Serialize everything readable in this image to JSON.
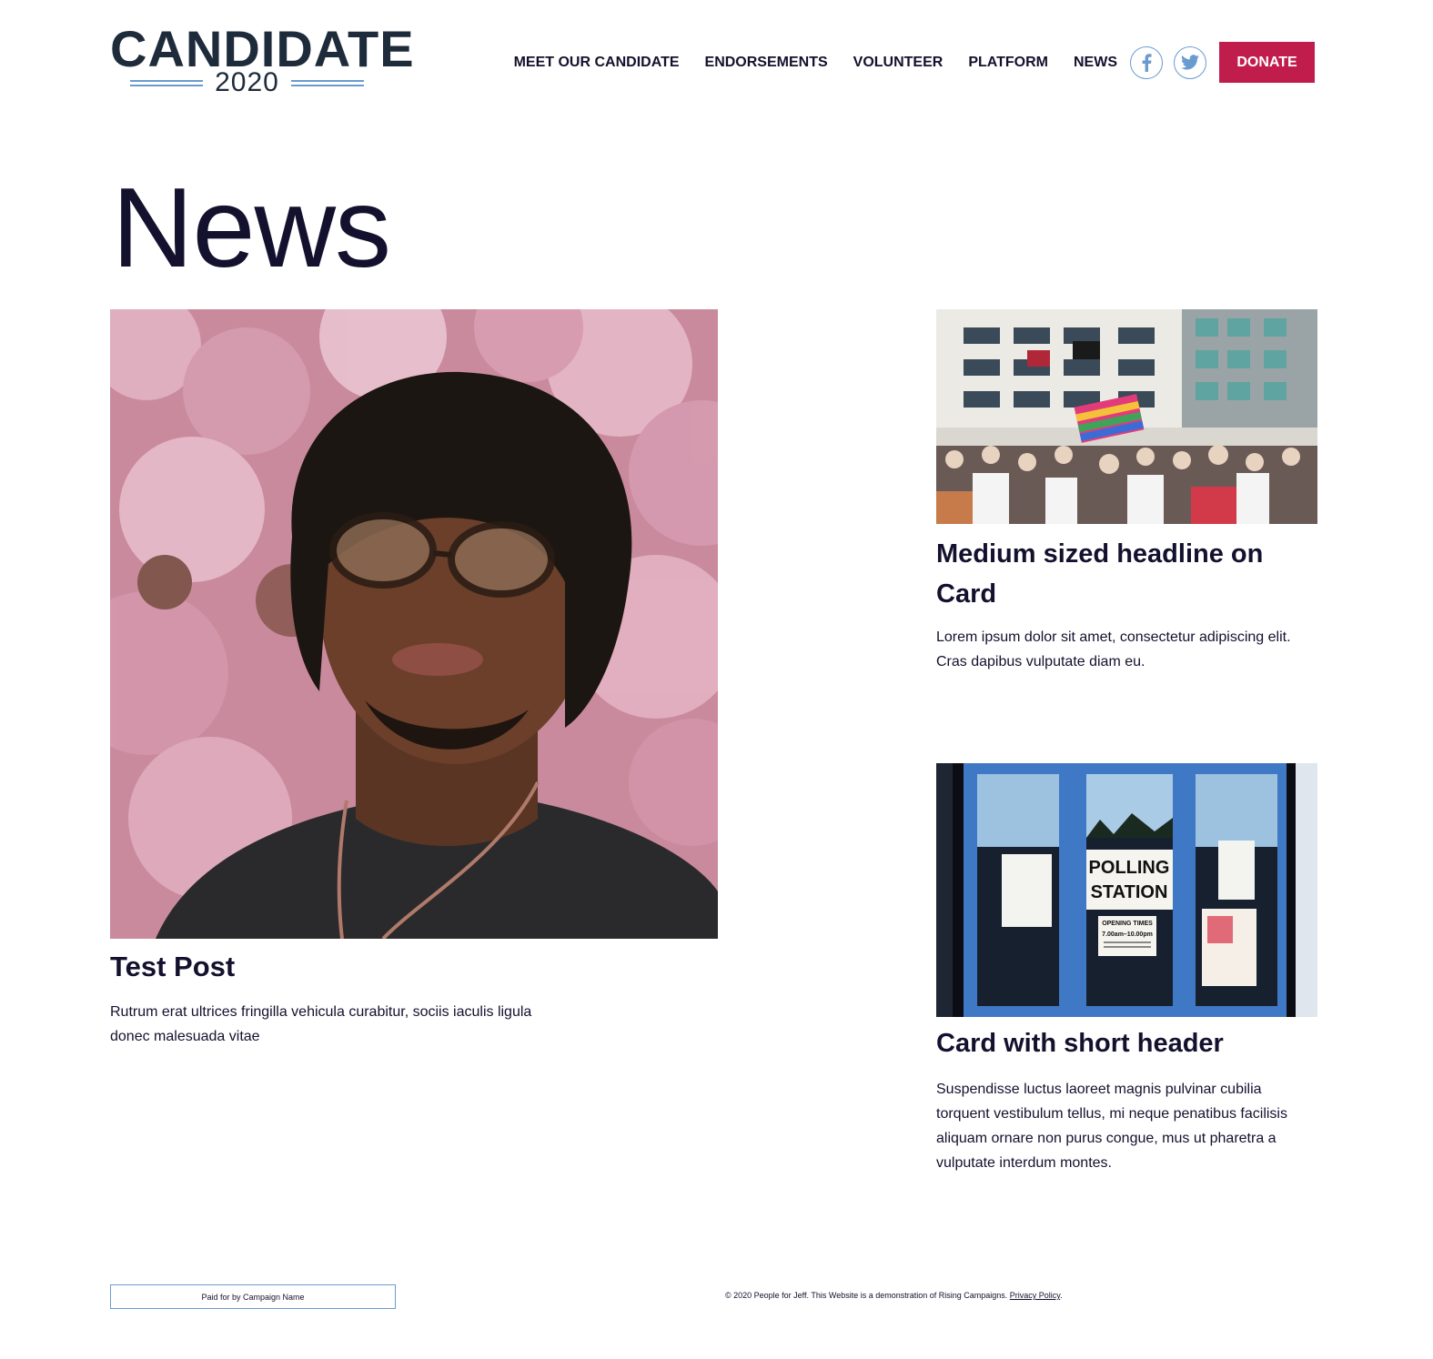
{
  "header": {
    "logo": {
      "word": "CANDIDATE",
      "year": "2020"
    },
    "nav": [
      {
        "label": "MEET OUR CANDIDATE"
      },
      {
        "label": "ENDORSEMENTS"
      },
      {
        "label": "VOLUNTEER"
      },
      {
        "label": "PLATFORM"
      },
      {
        "label": "NEWS"
      }
    ],
    "social": [
      {
        "icon": "facebook-icon"
      },
      {
        "icon": "twitter-icon"
      }
    ],
    "donate_label": "DONATE"
  },
  "page": {
    "title": "News"
  },
  "cards": [
    {
      "image": "portrait-photo",
      "title": "Test Post",
      "text": "Rutrum erat ultrices fringilla vehicula curabitur, sociis iaculis ligula donec malesuada vitae"
    },
    {
      "image": "parade-photo",
      "title": "Medium sized headline on Card",
      "text": "Lorem ipsum dolor sit amet, consectetur adipiscing elit. Cras dapibus vulputate diam eu."
    },
    {
      "image": "polling-station-photo",
      "image_text": {
        "line1": "POLLING",
        "line2": "STATION",
        "hours_label": "OPENING TIMES",
        "hours": "7.00am–10.00pm"
      },
      "title": "Card with short header",
      "text": "Suspendisse luctus laoreet magnis pulvinar cubilia torquent vestibulum tellus, mi neque penatibus facilisis aliquam ornare non purus congue, mus ut pharetra a vulputate interdum montes."
    }
  ],
  "footer": {
    "paid_for": "Paid for by Campaign Name",
    "copyright": "© 2020 People for Jeff. This Website is a demonstration of Rising Campaigns. ",
    "privacy_link": "Privacy Policy",
    "after_link": "."
  },
  "colors": {
    "brand_dark": "#1e2b3a",
    "text": "#14112e",
    "accent_blue": "#6a9bd0",
    "donate_red": "#c01c4c"
  }
}
